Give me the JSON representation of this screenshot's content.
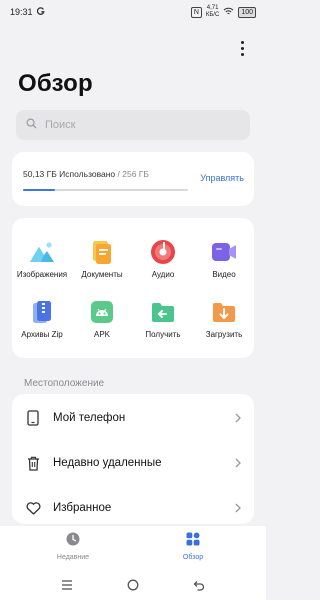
{
  "status_bar": {
    "time": "19:31",
    "carrier_icon": "g-icon",
    "nfc_badge": "N",
    "speed_value": "4,71",
    "speed_unit": "КБ/С",
    "battery_level": "100"
  },
  "header": {
    "title": "Обзор",
    "more_icon": "more-vert-icon"
  },
  "search": {
    "placeholder": "Поиск"
  },
  "storage": {
    "used_text": "50,13 ГБ Использовано",
    "total_text": " / 256 ГБ",
    "used_fraction": 0.196,
    "manage_label": "Управлять",
    "accent_color": "#3b78e7"
  },
  "categories": [
    {
      "id": "images",
      "label": "Изображения",
      "icon": "images-icon"
    },
    {
      "id": "docs",
      "label": "Документы",
      "icon": "documents-icon"
    },
    {
      "id": "audio",
      "label": "Аудио",
      "icon": "audio-icon"
    },
    {
      "id": "video",
      "label": "Видео",
      "icon": "video-icon"
    },
    {
      "id": "zip",
      "label": "Архивы Zip",
      "icon": "zip-icon"
    },
    {
      "id": "apk",
      "label": "APK",
      "icon": "apk-icon"
    },
    {
      "id": "receive",
      "label": "Получить",
      "icon": "receive-icon"
    },
    {
      "id": "downloads",
      "label": "Загрузить",
      "icon": "download-icon"
    }
  ],
  "locations": {
    "section_label": "Местоположение",
    "items": [
      {
        "label": "Мой телефон",
        "icon": "phone-icon"
      },
      {
        "label": "Недавно удаленные",
        "icon": "trash-icon"
      },
      {
        "label": "Избранное",
        "icon": "heart-icon"
      }
    ]
  },
  "bottom_nav": {
    "items": [
      {
        "label": "Недавние",
        "icon": "clock-icon",
        "active": false
      },
      {
        "label": "Обзор",
        "icon": "grid-icon",
        "active": true
      }
    ],
    "active_color": "#3b6fe0",
    "inactive_color": "#8a8a8e"
  },
  "system_nav": [
    "menu-icon",
    "home-icon",
    "back-icon"
  ]
}
